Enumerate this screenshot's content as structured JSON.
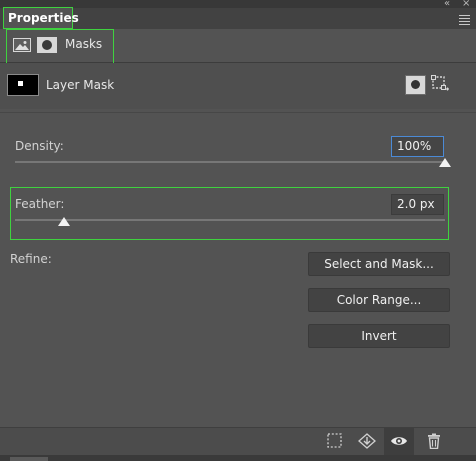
{
  "panel": {
    "tab_title": "Properties",
    "window_controls": [
      "«",
      "×"
    ]
  },
  "masks": {
    "label": "Masks",
    "icons": [
      "image-mask-icon",
      "pixel-mask-icon"
    ]
  },
  "layer_mask": {
    "label": "Layer Mask",
    "buttons": [
      "add-pixel-mask-icon",
      "add-vector-mask-icon"
    ]
  },
  "density": {
    "label": "Density:",
    "value": "100%",
    "level_percent": 100
  },
  "feather": {
    "label": "Feather:",
    "value": "2.0 px",
    "level_fraction": 0.02
  },
  "refine": {
    "label": "Refine:",
    "buttons": {
      "select_and_mask": "Select and Mask...",
      "color_range": "Color Range...",
      "invert": "Invert"
    }
  },
  "bottom_bar": {
    "icons": [
      "load-selection-icon",
      "apply-mask-icon",
      "toggle-visibility-icon",
      "delete-mask-icon"
    ]
  },
  "colors": {
    "panel_bg": "#535353",
    "highlight": "#3fd23f",
    "focus": "#4b8ad6"
  }
}
